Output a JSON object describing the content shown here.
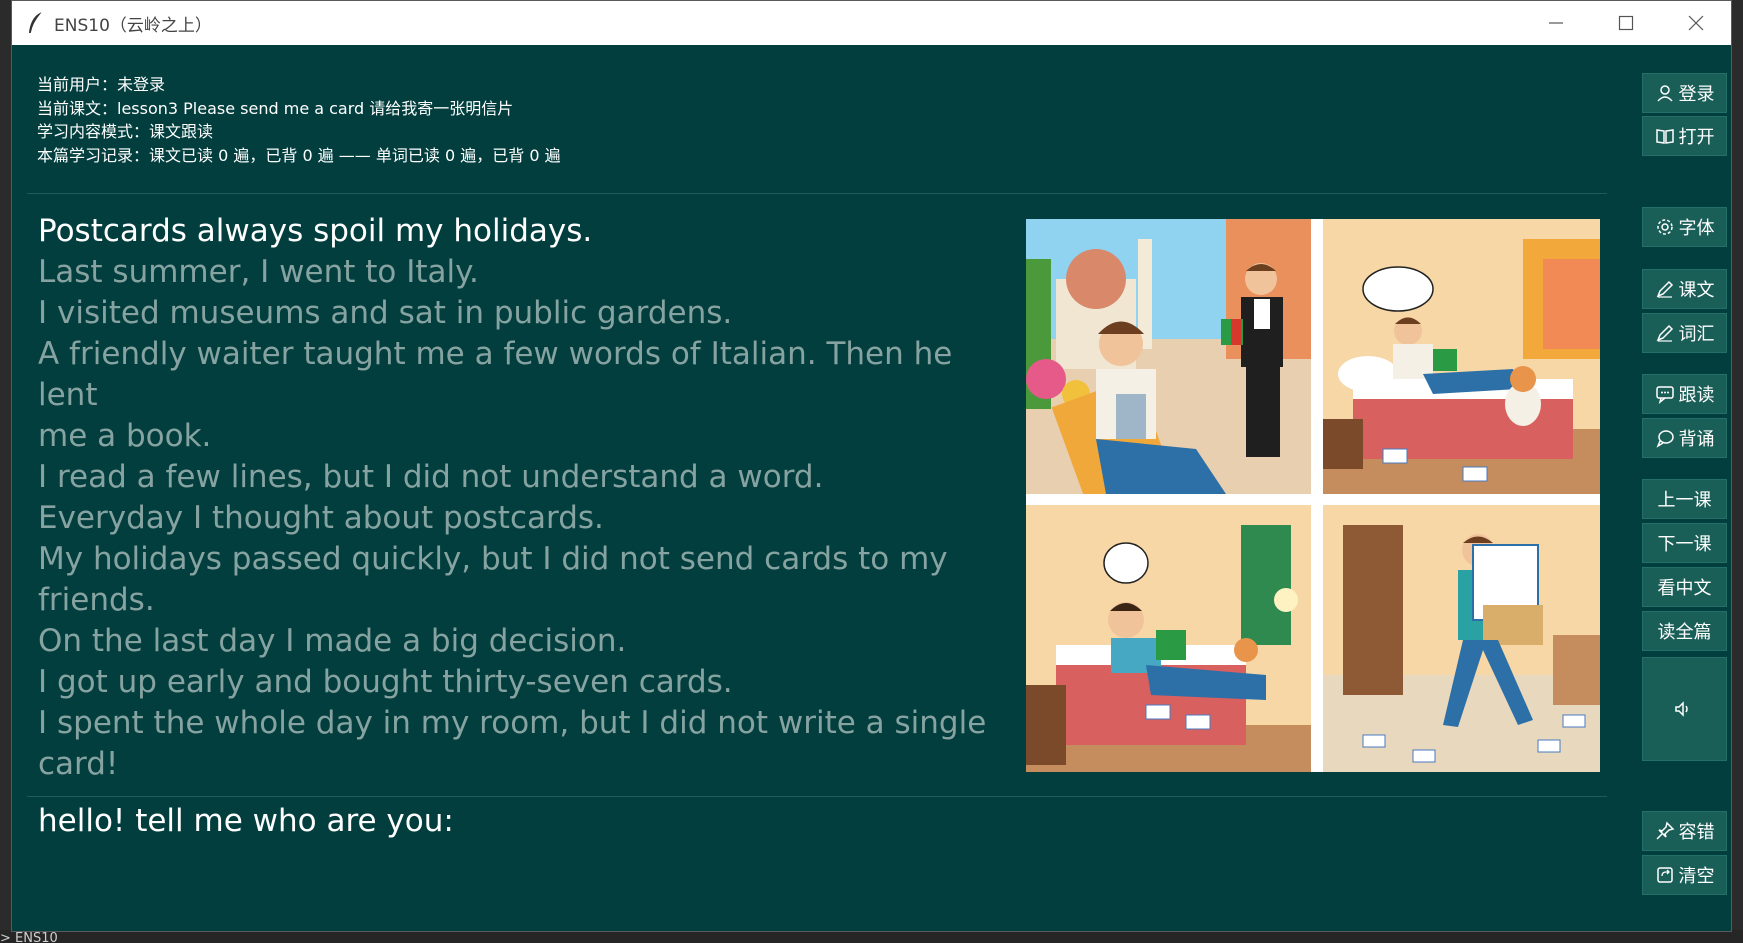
{
  "window": {
    "title": "ENS10（云岭之上）",
    "controls": [
      "minimize",
      "maximize",
      "close"
    ]
  },
  "background": {
    "bottom_text": "> ENS10"
  },
  "info": {
    "user": "当前用户：未登录",
    "lesson": "当前课文：lesson3  Please send me a card  请给我寄一张明信片",
    "mode": "学习内容模式：课文跟读",
    "record": "本篇学习记录：课文已读 0 遍，已背 0 遍 —— 单词已读 0 遍，已背 0 遍"
  },
  "lesson_lines": [
    "Postcards always spoil my holidays.",
    "Last summer, I went to Italy.",
    "I visited museums and sat in public gardens.",
    "A friendly waiter taught me a few words of Italian. Then he lent",
    "me a book.",
    "I read a few lines, but I did not understand a word.",
    "Everyday I thought about postcards.",
    "My holidays passed quickly, but I did not send cards to my",
    "friends.",
    "On the last day I made a big decision.",
    "I got up early and bought thirty-seven cards.",
    "I spent the whole day in my room, but I did not write a single",
    "card!"
  ],
  "prompt": "hello! tell me who are you:",
  "sidebar": {
    "login": "登录",
    "open": "打开",
    "font": "字体",
    "text": "课文",
    "vocab": "词汇",
    "follow": "跟读",
    "recite": "背诵",
    "prev": "上一课",
    "next": "下一课",
    "chinese": "看中文",
    "read_all": "读全篇",
    "tolerance": "容错",
    "clear": "清空"
  },
  "colors": {
    "window_bg": "#023e3e",
    "button_bg": "#1a5e58",
    "current_line": "#ffffff",
    "other_line": "#86a3a1"
  }
}
